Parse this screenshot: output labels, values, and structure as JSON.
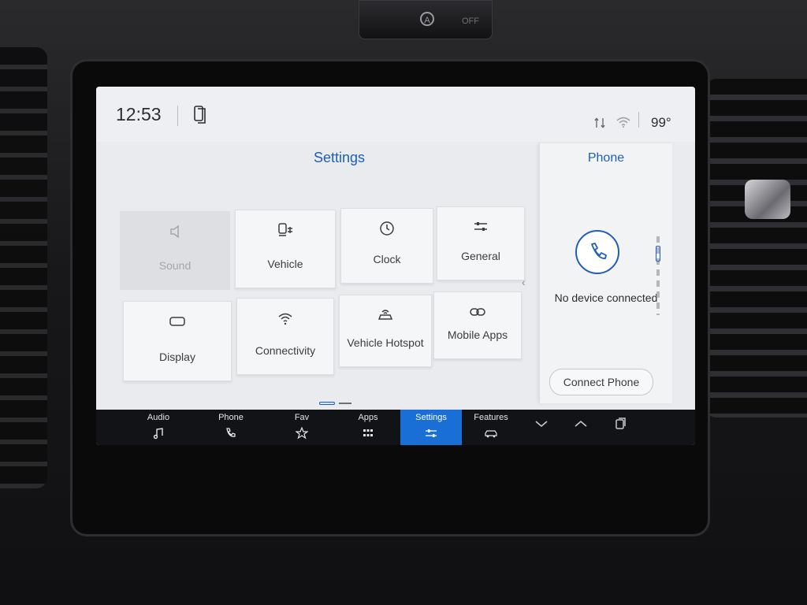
{
  "hardware": {
    "top_button_off_label": "OFF",
    "top_button_icon": "auto-start-stop-icon"
  },
  "statusbar": {
    "time": "12:53",
    "temperature": "99°",
    "icons": [
      "phone-projection-icon",
      "signal-icon",
      "wifi-icon"
    ]
  },
  "settings": {
    "title": "Settings",
    "tiles": [
      {
        "label": "Sound",
        "icon": "speaker-icon",
        "enabled": false
      },
      {
        "label": "Vehicle",
        "icon": "vehicle-settings-icon",
        "enabled": true
      },
      {
        "label": "Clock",
        "icon": "clock-icon",
        "enabled": true
      },
      {
        "label": "General",
        "icon": "sliders-icon",
        "enabled": true
      },
      {
        "label": "Display",
        "icon": "display-icon",
        "enabled": true
      },
      {
        "label": "Connectivity",
        "icon": "wifi-icon",
        "enabled": true
      },
      {
        "label": "Vehicle Hotspot",
        "icon": "hotspot-icon",
        "enabled": true
      },
      {
        "label": "Mobile Apps",
        "icon": "link-icon",
        "enabled": true
      }
    ],
    "pages": {
      "current": 1,
      "total": 2
    }
  },
  "phone_panel": {
    "title": "Phone",
    "status": "No device connected",
    "connect_label": "Connect Phone"
  },
  "navbar": {
    "items": [
      {
        "label": "Audio",
        "icon": "music-note-icon"
      },
      {
        "label": "Phone",
        "icon": "phone-icon"
      },
      {
        "label": "Fav",
        "icon": "star-plus-icon"
      },
      {
        "label": "Apps",
        "icon": "grid-icon"
      },
      {
        "label": "Settings",
        "icon": "sliders-icon",
        "active": true
      },
      {
        "label": "Features",
        "icon": "car-icon"
      }
    ],
    "controls": [
      "chevron-down-icon",
      "chevron-up-icon",
      "copy-icon"
    ]
  },
  "colors": {
    "accent": "#1d5fb8",
    "active_tab": "#1a6fd6",
    "navbar_bg": "#121316",
    "screen_bg": "#e9ebee"
  }
}
